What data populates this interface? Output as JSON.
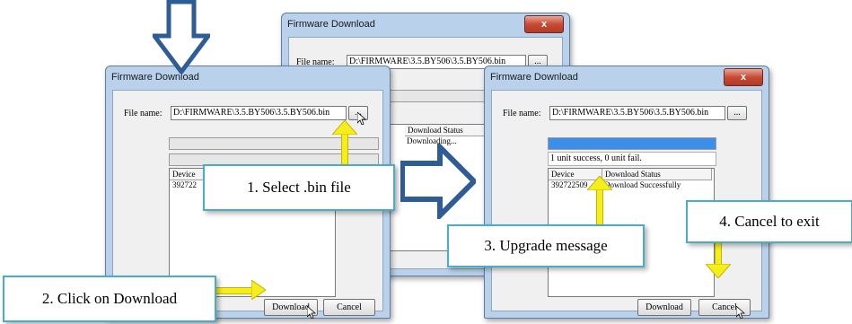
{
  "windows": {
    "back": {
      "title": "Firmware Download",
      "close": "x",
      "file_label": "File name:",
      "file_value": "D:\\FIRMWARE\\3.5.BY506\\3.5.BY506.bin",
      "browse": "...",
      "list_col2": "Download Status",
      "row_status": "Downloading..."
    },
    "left": {
      "title": "Firmware Download",
      "file_label": "File name:",
      "file_value": "D:\\FIRMWARE\\3.5.BY506\\3.5.BY506.bin",
      "browse": "...",
      "list_col1": "Device",
      "row_device": "392722",
      "download": "Download",
      "cancel": "Cancel"
    },
    "right": {
      "title": "Firmware Download",
      "close": "x",
      "file_label": "File name:",
      "file_value": "D:\\FIRMWARE\\3.5.BY506\\3.5.BY506.bin",
      "browse": "...",
      "message": "1 unit success, 0 unit fail.",
      "list_col1": "Device",
      "list_col2": "Download Status",
      "row_device": "392722509",
      "row_status": "Download Successfully",
      "download": "Download",
      "cancel": "Cancel",
      "progress": 1.0
    }
  },
  "callouts": {
    "step1": "1. Select .bin file",
    "step2": "2. Click on Download",
    "step3": "3. Upgrade message",
    "step4": "4. Cancel to exit"
  },
  "colors": {
    "arrow_blue": "#2e5c96",
    "yellow_arrow": "#f4ef1a",
    "callout_border": "#4bacc6",
    "progress": "#3b8fe8"
  }
}
